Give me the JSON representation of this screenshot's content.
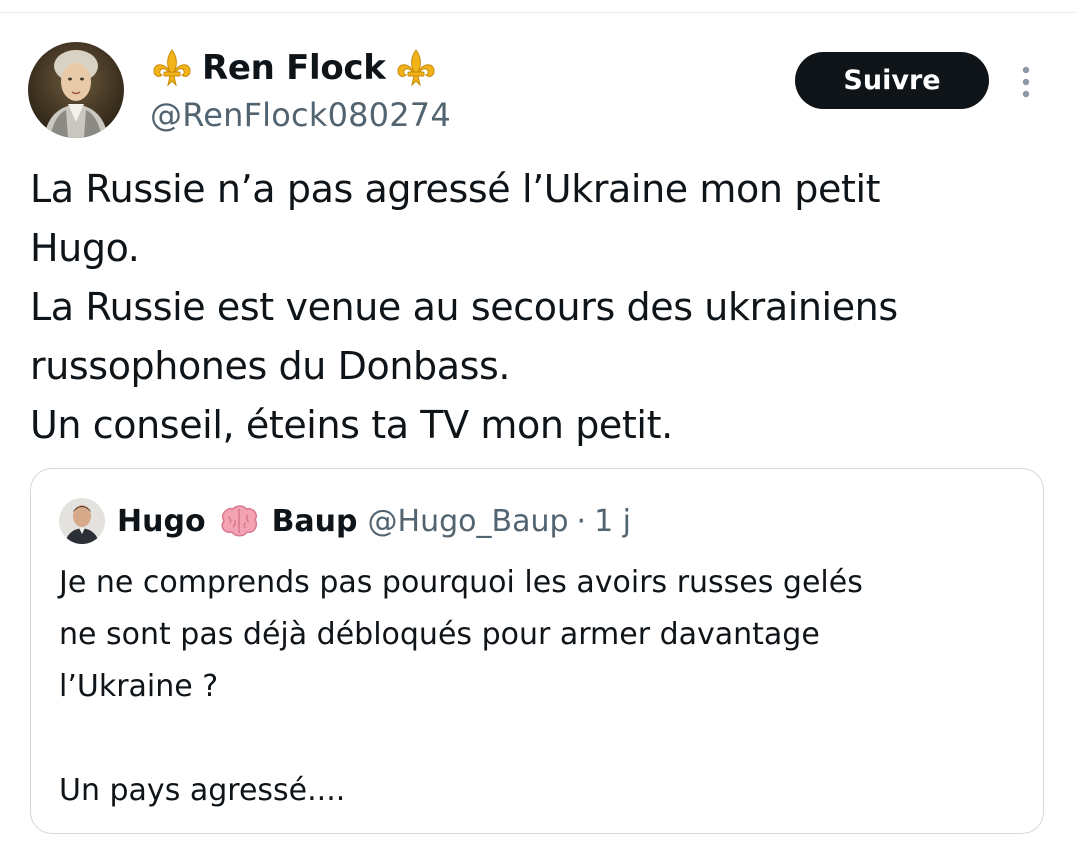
{
  "author": {
    "display_name": "Ren Flock",
    "handle": "@RenFlock080274",
    "name_decoration_icon": "fleur-de-lis-icon",
    "avatar": "portrait-avatar"
  },
  "follow_button": {
    "label": "Suivre"
  },
  "more_menu": {
    "icon": "more-vertical-icon"
  },
  "tweet": {
    "lines": [
      "La Russie n’a pas agressé l’Ukraine mon petit",
      "Hugo.",
      "La Russie est venue au secours des ukrainiens",
      "russophones du Donbass.",
      "Un conseil, éteins ta TV mon petit."
    ]
  },
  "quoted_tweet": {
    "name_part_1": "Hugo",
    "name_emoji": "brain-emoji-icon",
    "name_part_2": "Baup",
    "handle": "@Hugo_Baup",
    "separator": "·",
    "time": "1 j",
    "lines": [
      "Je ne comprends pas pourquoi les avoirs russes gelés",
      "ne sont pas déjà débloqués pour armer davantage",
      "l’Ukraine ?",
      "",
      "Un pays agressé...."
    ]
  },
  "colors": {
    "text_primary": "#0f1419",
    "text_secondary": "#536471",
    "border": "#cfd9de",
    "fleur_gold": "#f2b31a",
    "follow_bg": "#0f1419",
    "follow_text": "#ffffff"
  }
}
